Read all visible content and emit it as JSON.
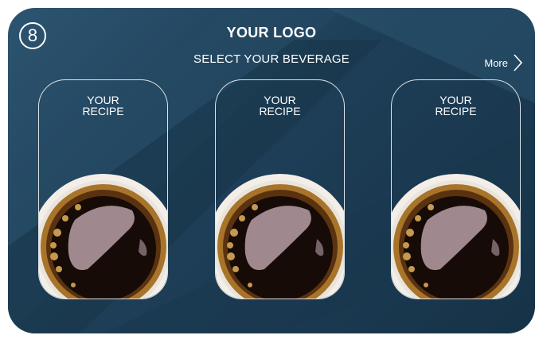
{
  "badge": {
    "number": "8"
  },
  "header": {
    "logo_text": "YOUR LOGO",
    "subtitle": "SELECT YOUR BEVERAGE"
  },
  "more": {
    "label": "More",
    "icon": "chevron-right-icon"
  },
  "cards": [
    {
      "line1": "YOUR",
      "line2": "RECIPE",
      "image": "coffee-cup-image"
    },
    {
      "line1": "YOUR",
      "line2": "RECIPE",
      "image": "coffee-cup-image"
    },
    {
      "line1": "YOUR",
      "line2": "RECIPE",
      "image": "coffee-cup-image"
    }
  ],
  "colors": {
    "background": "#1e3f58",
    "background_light": "#2c5470",
    "text": "#ffffff",
    "coffee": "#160b06",
    "crema": "#a8742a"
  }
}
